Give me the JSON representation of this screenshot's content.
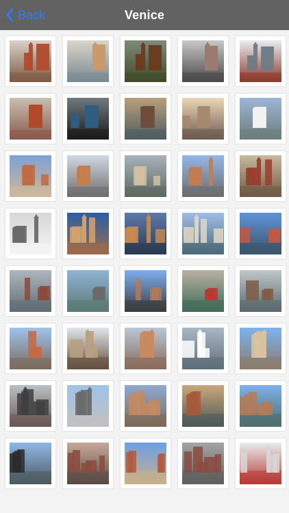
{
  "navbar": {
    "back_label": "Back",
    "title": "Venice",
    "accent_color": "#2f7cf6",
    "back_icon": "chevron-left-icon"
  },
  "photos": [
    {
      "id": 1,
      "sky": "#d8d2c8",
      "ground": "#7e5b46",
      "accent": "#b44b2f"
    },
    {
      "id": 2,
      "sky": "#d9d5c8",
      "ground": "#7a8a92",
      "accent": "#c99a6a"
    },
    {
      "id": 3,
      "sky": "#7f8b78",
      "ground": "#3f4b2a",
      "accent": "#6b3c1e"
    },
    {
      "id": 4,
      "sky": "#c7c7c7",
      "ground": "#4a4a4a",
      "accent": "#9a7b6f"
    },
    {
      "id": 5,
      "sky": "#e9ecef",
      "ground": "#8c3b2d",
      "accent": "#6f7b86"
    },
    {
      "id": 6,
      "sky": "#c9bfb1",
      "ground": "#8a5a4d",
      "accent": "#b04a2b"
    },
    {
      "id": 7,
      "sky": "#6f7a80",
      "ground": "#1b1b1b",
      "accent": "#2d5e82"
    },
    {
      "id": 8,
      "sky": "#b9a07b",
      "ground": "#4f5d62",
      "accent": "#6f4d3c"
    },
    {
      "id": 9,
      "sky": "#e9d7b7",
      "ground": "#705c52",
      "accent": "#a7886f"
    },
    {
      "id": 10,
      "sky": "#9cb6d8",
      "ground": "#6d7d7b",
      "accent": "#f1f2f1"
    },
    {
      "id": 11,
      "sky": "#7da2d3",
      "ground": "#cdb79b",
      "accent": "#bf6b41"
    },
    {
      "id": 12,
      "sky": "#cfd8e2",
      "ground": "#6f6f6f",
      "accent": "#c67e4c"
    },
    {
      "id": 13,
      "sky": "#a8b2bb",
      "ground": "#5e6a61",
      "accent": "#d2c1a2"
    },
    {
      "id": 14,
      "sky": "#93b7e8",
      "ground": "#6d6d6d",
      "accent": "#c17c52"
    },
    {
      "id": 15,
      "sky": "#c5b99f",
      "ground": "#6f5b45",
      "accent": "#9a3d2e"
    },
    {
      "id": 16,
      "sky": "#d7d7d7",
      "ground": "#f4f4f4",
      "accent": "#6b6b6b"
    },
    {
      "id": 17,
      "sky": "#2c5ea6",
      "ground": "#9c6b4b",
      "accent": "#d4a36f"
    },
    {
      "id": 18,
      "sky": "#5d7aa8",
      "ground": "#2c3b54",
      "accent": "#c58a4f"
    },
    {
      "id": 19,
      "sky": "#9fbde6",
      "ground": "#4f6b7a",
      "accent": "#e0d7c6"
    },
    {
      "id": 20,
      "sky": "#5f93d6",
      "ground": "#3a566b",
      "accent": "#c05b42"
    },
    {
      "id": 21,
      "sky": "#aeb6bd",
      "ground": "#616d74",
      "accent": "#8b4a3a"
    },
    {
      "id": 22,
      "sky": "#8fb3d6",
      "ground": "#5b7a73",
      "accent": "#6a6a6a"
    },
    {
      "id": 23,
      "sky": "#7eaef0",
      "ground": "#3c3c3c",
      "accent": "#b17a57"
    },
    {
      "id": 24,
      "sky": "#b9b0a2",
      "ground": "#3f6b57",
      "accent": "#b73a32"
    },
    {
      "id": 25,
      "sky": "#bfc7c9",
      "ground": "#5a6a6e",
      "accent": "#7f5b47"
    },
    {
      "id": 26,
      "sky": "#9ec3ea",
      "ground": "#7b6b5d",
      "accent": "#c56a45"
    },
    {
      "id": 27,
      "sky": "#dfe5ea",
      "ground": "#65503f",
      "accent": "#b9a07f"
    },
    {
      "id": 28,
      "sky": "#b8c7d6",
      "ground": "#8a6c5c",
      "accent": "#c98a60"
    },
    {
      "id": 29,
      "sky": "#a8b7c6",
      "ground": "#5f6f79",
      "accent": "#ffffff"
    },
    {
      "id": 30,
      "sky": "#7db3f0",
      "ground": "#8a7b6c",
      "accent": "#d8c3a0"
    },
    {
      "id": 31,
      "sky": "#b9c0c4",
      "ground": "#6a5a55",
      "accent": "#3f3f3f"
    },
    {
      "id": 32,
      "sky": "#9fc2e8",
      "ground": "#c1c1c1",
      "accent": "#6b6b6b"
    },
    {
      "id": 33,
      "sky": "#8eaad0",
      "ground": "#7c6a5a",
      "accent": "#c58b62"
    },
    {
      "id": 34,
      "sky": "#caa67a",
      "ground": "#4f5a58",
      "accent": "#a45a3b"
    },
    {
      "id": 35,
      "sky": "#7fb1ea",
      "ground": "#4f6d6c",
      "accent": "#b57b56"
    },
    {
      "id": 36,
      "sky": "#8fb7e6",
      "ground": "#4e5a60",
      "accent": "#2b2b2b"
    },
    {
      "id": 37,
      "sky": "#c7a89a",
      "ground": "#5a4a45",
      "accent": "#8a4b3d"
    },
    {
      "id": 38,
      "sky": "#6c9fe5",
      "ground": "#c9b08a",
      "accent": "#b15b3e"
    },
    {
      "id": 39,
      "sky": "#a4a4a4",
      "ground": "#5f5f5f",
      "accent": "#8b4b3f"
    },
    {
      "id": 40,
      "sky": "#e9ecee",
      "ground": "#b63b34",
      "accent": "#d7d7d7"
    }
  ]
}
